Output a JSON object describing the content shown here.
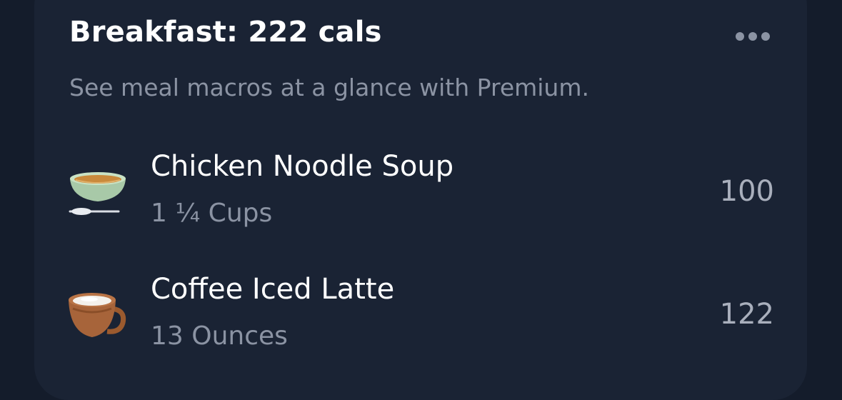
{
  "meal": {
    "title": "Breakfast: 222 cals",
    "subtitle": "See meal macros at a glance with Premium.",
    "more_icon": "ellipsis-icon"
  },
  "foods": [
    {
      "name": "Chicken Noodle Soup",
      "portion": "1 ¼ Cups",
      "calories": "100",
      "icon": "soup-bowl-icon"
    },
    {
      "name": "Coffee Iced Latte",
      "portion": "13 Ounces",
      "calories": "122",
      "icon": "coffee-cup-icon"
    }
  ],
  "colors": {
    "background": "#141c2b",
    "card": "#1a2334",
    "primary_text": "#ffffff",
    "secondary_text": "#8b93a3"
  }
}
